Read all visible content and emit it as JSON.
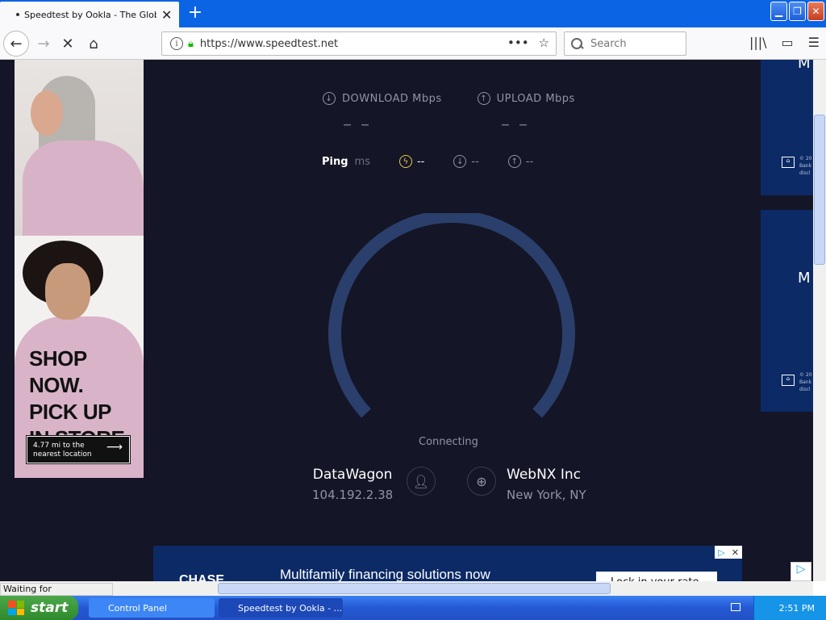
{
  "browser": {
    "tab_title": "Speedtest by Ookla - The Global B",
    "new_tab": "+",
    "url": "https://www.speedtest.net",
    "search_placeholder": "Search",
    "status_text": "Waiting for io.narrative.io..."
  },
  "speedtest": {
    "download_label": "DOWNLOAD Mbps",
    "upload_label": "UPLOAD Mbps",
    "download_value": "– –",
    "upload_value": "– –",
    "ping_label": "Ping",
    "ping_unit": "ms",
    "ping_idle": "--",
    "ping_down": "--",
    "ping_up": "--",
    "status": "Connecting",
    "isp_name": "DataWagon",
    "isp_ip": "104.192.2.38",
    "server_name": "WebNX Inc",
    "server_location": "New York, NY",
    "accent_color": "#2a3f6b"
  },
  "ads": {
    "left_headline": [
      "SHOP NOW.",
      "PICK UP",
      "IN STORE."
    ],
    "left_cta": [
      "4.77 mi to the",
      "nearest location"
    ],
    "right_letter": "M",
    "bottom_brand": "CHASE",
    "bottom_text": "Multifamily financing solutions now",
    "bottom_button": "Lock in your rate"
  },
  "taskbar": {
    "start": "start",
    "items": [
      "Control Panel",
      "Speedtest by Ookla - ..."
    ],
    "clock": "2:51 PM"
  }
}
